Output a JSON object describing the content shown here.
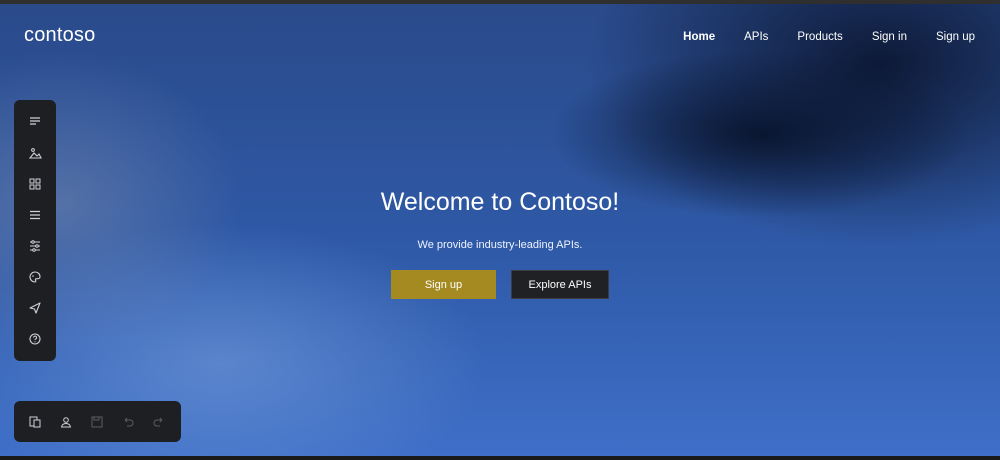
{
  "header": {
    "logo": "contoso",
    "nav": [
      {
        "label": "Home",
        "active": true
      },
      {
        "label": "APIs",
        "active": false
      },
      {
        "label": "Products",
        "active": false
      },
      {
        "label": "Sign in",
        "active": false
      },
      {
        "label": "Sign up",
        "active": false
      }
    ]
  },
  "hero": {
    "title": "Welcome to Contoso!",
    "subtitle": "We provide industry-leading APIs.",
    "primary_button": "Sign up",
    "secondary_button": "Explore APIs"
  },
  "editor_toolbar": {
    "items": [
      "text-icon",
      "media-icon",
      "layout-icon",
      "menu-icon",
      "settings-sliders-icon",
      "palette-icon",
      "publish-icon",
      "help-icon"
    ]
  },
  "bottom_toolbar": {
    "items": [
      "pages-icon",
      "user-icon",
      "save-icon",
      "undo-icon",
      "redo-icon"
    ]
  },
  "colors": {
    "primary_button": "#a48a21",
    "secondary_button": "#1f2124",
    "toolbar": "#1e1f22",
    "hero_blue": "#3f6fc8"
  }
}
